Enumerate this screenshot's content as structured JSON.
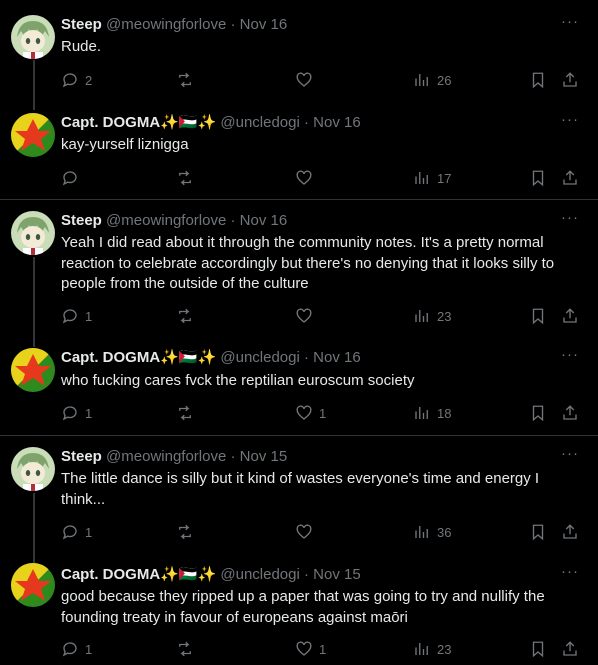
{
  "users": {
    "steep": {
      "name": "Steep",
      "handle": "@meowingforlove"
    },
    "dogma": {
      "name": "Capt. DOGMA",
      "name_extra": "✨🇵🇸✨",
      "handle": "@uncledogi"
    }
  },
  "separator": "·",
  "more_icon": "···",
  "colors": {
    "background": "#000000",
    "text": "#e7e9ea",
    "muted": "#71767b",
    "divider": "#2f3336"
  },
  "tweets": [
    {
      "user": "steep",
      "date": "Nov 16",
      "text": "Rude.",
      "replies": "2",
      "retweets": "",
      "likes": "",
      "views": "26"
    },
    {
      "user": "dogma",
      "date": "Nov 16",
      "text": "kay-yurself liznigga",
      "replies": "",
      "retweets": "",
      "likes": "",
      "views": "17"
    },
    {
      "user": "steep",
      "date": "Nov 16",
      "text": "Yeah I did read about it through the community notes. It's a pretty normal reaction to celebrate accordingly but there's no denying that it looks silly to people from the outside of the culture",
      "replies": "1",
      "retweets": "",
      "likes": "",
      "views": "23"
    },
    {
      "user": "dogma",
      "date": "Nov 16",
      "text": "who fucking cares fvck the reptilian euroscum society",
      "replies": "1",
      "retweets": "",
      "likes": "1",
      "views": "18"
    },
    {
      "user": "steep",
      "date": "Nov 15",
      "text": "The little dance is silly but it kind of wastes everyone's time and energy I think...",
      "replies": "1",
      "retweets": "",
      "likes": "",
      "views": "36"
    },
    {
      "user": "dogma",
      "date": "Nov 15",
      "text": "good because they ripped up a paper that was going to try and nullify the founding treaty in favour of europeans against maōri",
      "replies": "1",
      "retweets": "",
      "likes": "1",
      "views": "23"
    }
  ]
}
